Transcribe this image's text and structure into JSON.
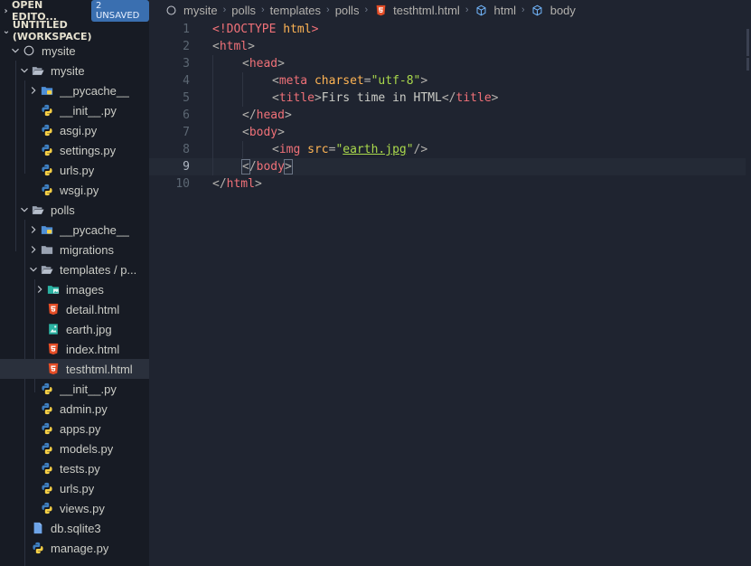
{
  "open_editors": {
    "label": "OPEN EDITO...",
    "badge": "2 UNSAVED"
  },
  "workspace": {
    "label": "UNTITLED (WORKSPACE)"
  },
  "tree": [
    {
      "label": "mysite",
      "icon": "workspace-root-icon",
      "twisty": "open"
    },
    {
      "label": "mysite",
      "icon": "folder-open-icon",
      "twisty": "open"
    },
    {
      "label": "__pycache__",
      "icon": "pycache-folder-icon",
      "twisty": "closed"
    },
    {
      "label": "__init__.py",
      "icon": "python-icon",
      "twisty": ""
    },
    {
      "label": "asgi.py",
      "icon": "python-icon",
      "twisty": ""
    },
    {
      "label": "settings.py",
      "icon": "python-icon",
      "twisty": ""
    },
    {
      "label": "urls.py",
      "icon": "python-icon",
      "twisty": ""
    },
    {
      "label": "wsgi.py",
      "icon": "python-icon",
      "twisty": ""
    },
    {
      "label": "polls",
      "icon": "folder-open-icon",
      "twisty": "open"
    },
    {
      "label": "__pycache__",
      "icon": "pycache-folder-icon",
      "twisty": "closed"
    },
    {
      "label": "migrations",
      "icon": "folder-icon",
      "twisty": "closed"
    },
    {
      "label": "templates / p...",
      "icon": "folder-open-icon",
      "twisty": "open"
    },
    {
      "label": "images",
      "icon": "images-folder-icon",
      "twisty": "closed"
    },
    {
      "label": "detail.html",
      "icon": "html5-icon",
      "twisty": ""
    },
    {
      "label": "earth.jpg",
      "icon": "image-file-icon",
      "twisty": ""
    },
    {
      "label": "index.html",
      "icon": "html5-icon",
      "twisty": ""
    },
    {
      "label": "testhtml.html",
      "icon": "html5-icon",
      "twisty": "",
      "selected": true
    },
    {
      "label": "__init__.py",
      "icon": "python-icon",
      "twisty": ""
    },
    {
      "label": "admin.py",
      "icon": "python-icon",
      "twisty": ""
    },
    {
      "label": "apps.py",
      "icon": "python-icon",
      "twisty": ""
    },
    {
      "label": "models.py",
      "icon": "python-icon",
      "twisty": ""
    },
    {
      "label": "tests.py",
      "icon": "python-icon",
      "twisty": ""
    },
    {
      "label": "urls.py",
      "icon": "python-icon",
      "twisty": ""
    },
    {
      "label": "views.py",
      "icon": "python-icon",
      "twisty": ""
    },
    {
      "label": "db.sqlite3",
      "icon": "database-file-icon",
      "twisty": ""
    },
    {
      "label": "manage.py",
      "icon": "python-icon",
      "twisty": ""
    }
  ],
  "breadcrumbs": [
    {
      "label": "mysite",
      "icon": "workspace-root-icon"
    },
    {
      "label": "polls",
      "icon": ""
    },
    {
      "label": "templates",
      "icon": ""
    },
    {
      "label": "polls",
      "icon": ""
    },
    {
      "label": "testhtml.html",
      "icon": "html5-icon"
    },
    {
      "label": "html",
      "icon": "element-cube-icon"
    },
    {
      "label": "body",
      "icon": "element-cube-icon"
    }
  ],
  "editor": {
    "current_line": 9,
    "lines": [
      {
        "n": "1",
        "indent": 0,
        "tokens": [
          {
            "t": "<!",
            "c": "t-doc"
          },
          {
            "t": "DOCTYPE",
            "c": "t-doc"
          },
          {
            "t": " html",
            "c": "t-attr"
          },
          {
            "t": ">",
            "c": "t-doc"
          }
        ]
      },
      {
        "n": "2",
        "indent": 0,
        "tokens": [
          {
            "t": "<",
            "c": "t-punct"
          },
          {
            "t": "html",
            "c": "t-tag"
          },
          {
            "t": ">",
            "c": "t-punct"
          }
        ]
      },
      {
        "n": "3",
        "indent": 1,
        "tokens": [
          {
            "t": "<",
            "c": "t-punct"
          },
          {
            "t": "head",
            "c": "t-tag"
          },
          {
            "t": ">",
            "c": "t-punct"
          }
        ]
      },
      {
        "n": "4",
        "indent": 2,
        "tokens": [
          {
            "t": "<",
            "c": "t-punct"
          },
          {
            "t": "meta",
            "c": "t-tag"
          },
          {
            "t": " ",
            "c": "t-txt"
          },
          {
            "t": "charset",
            "c": "t-attr"
          },
          {
            "t": "=",
            "c": "t-punct"
          },
          {
            "t": "\"utf-8\"",
            "c": "t-str"
          },
          {
            "t": ">",
            "c": "t-punct"
          }
        ]
      },
      {
        "n": "5",
        "indent": 2,
        "tokens": [
          {
            "t": "<",
            "c": "t-punct"
          },
          {
            "t": "title",
            "c": "t-tag"
          },
          {
            "t": ">",
            "c": "t-punct"
          },
          {
            "t": "Firs time in HTML",
            "c": "t-txt"
          },
          {
            "t": "</",
            "c": "t-punct"
          },
          {
            "t": "title",
            "c": "t-tag"
          },
          {
            "t": ">",
            "c": "t-punct"
          }
        ]
      },
      {
        "n": "6",
        "indent": 1,
        "tokens": [
          {
            "t": "</",
            "c": "t-punct"
          },
          {
            "t": "head",
            "c": "t-tag"
          },
          {
            "t": ">",
            "c": "t-punct"
          }
        ]
      },
      {
        "n": "7",
        "indent": 1,
        "tokens": [
          {
            "t": "<",
            "c": "t-punct"
          },
          {
            "t": "body",
            "c": "t-tag"
          },
          {
            "t": ">",
            "c": "t-punct"
          }
        ]
      },
      {
        "n": "8",
        "indent": 2,
        "tokens": [
          {
            "t": "<",
            "c": "t-punct"
          },
          {
            "t": "img",
            "c": "t-tag"
          },
          {
            "t": " ",
            "c": "t-txt"
          },
          {
            "t": "src",
            "c": "t-attr"
          },
          {
            "t": "=",
            "c": "t-punct"
          },
          {
            "t": "\"",
            "c": "t-str"
          },
          {
            "t": "earth.jpg",
            "c": "t-str ul"
          },
          {
            "t": "\"",
            "c": "t-str"
          },
          {
            "t": "/>",
            "c": "t-punct"
          }
        ]
      },
      {
        "n": "9",
        "indent": 1,
        "tokens": [
          {
            "t": "<",
            "c": "t-punct bracket"
          },
          {
            "t": "/",
            "c": "t-punct"
          },
          {
            "t": "body",
            "c": "t-tag"
          },
          {
            "t": ">",
            "c": "t-punct bracket"
          }
        ]
      },
      {
        "n": "10",
        "indent": 0,
        "tokens": [
          {
            "t": "</",
            "c": "t-punct"
          },
          {
            "t": "html",
            "c": "t-tag"
          },
          {
            "t": ">",
            "c": "t-punct"
          }
        ]
      }
    ]
  },
  "colors": {
    "python_blue": "#3e7fc1",
    "python_yellow": "#f7d046",
    "html_orange": "#e44d26",
    "folder": "#9aa3b2",
    "pycache": "#4f8fd6",
    "images_teal": "#2bb3a3"
  }
}
